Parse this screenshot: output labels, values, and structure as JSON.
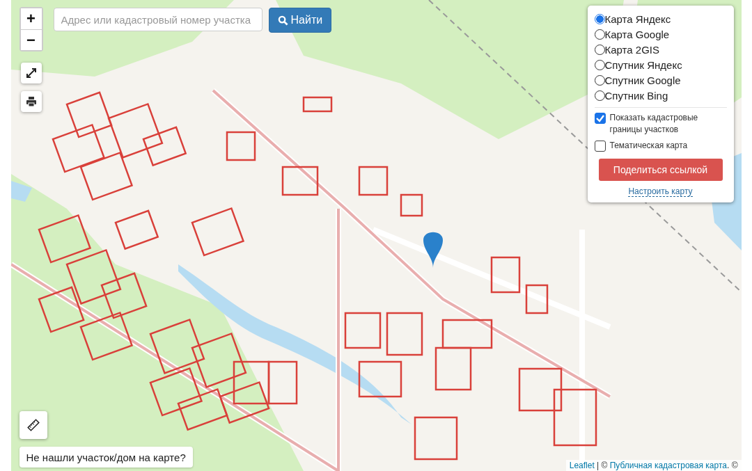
{
  "zoom": {
    "in": "+",
    "out": "−"
  },
  "search": {
    "placeholder": "Адрес или кадастровый номер участка",
    "button": "Найти"
  },
  "layers": [
    {
      "label": "Карта Яндекс",
      "selected": true
    },
    {
      "label": "Карта Google",
      "selected": false
    },
    {
      "label": "Карта 2GIS",
      "selected": false
    },
    {
      "label": "Спутник Яндекс",
      "selected": false
    },
    {
      "label": "Спутник Google",
      "selected": false
    },
    {
      "label": "Спутник Bing",
      "selected": false
    }
  ],
  "overlays": [
    {
      "label": "Показать кадастровые границы участков",
      "checked": true
    },
    {
      "label": "Тематическая карта",
      "checked": false
    }
  ],
  "share_button": "Поделиться ссылкой",
  "configure_link": "Настроить карту",
  "not_found_button": "Не нашли участок/дом на карте?",
  "attribution": [
    {
      "kind": "link",
      "text": "Leaflet"
    },
    {
      "kind": "text",
      "text": " | © "
    },
    {
      "kind": "link",
      "text": "Публичная кадастровая карта"
    },
    {
      "kind": "text",
      "text": ". ©"
    }
  ]
}
